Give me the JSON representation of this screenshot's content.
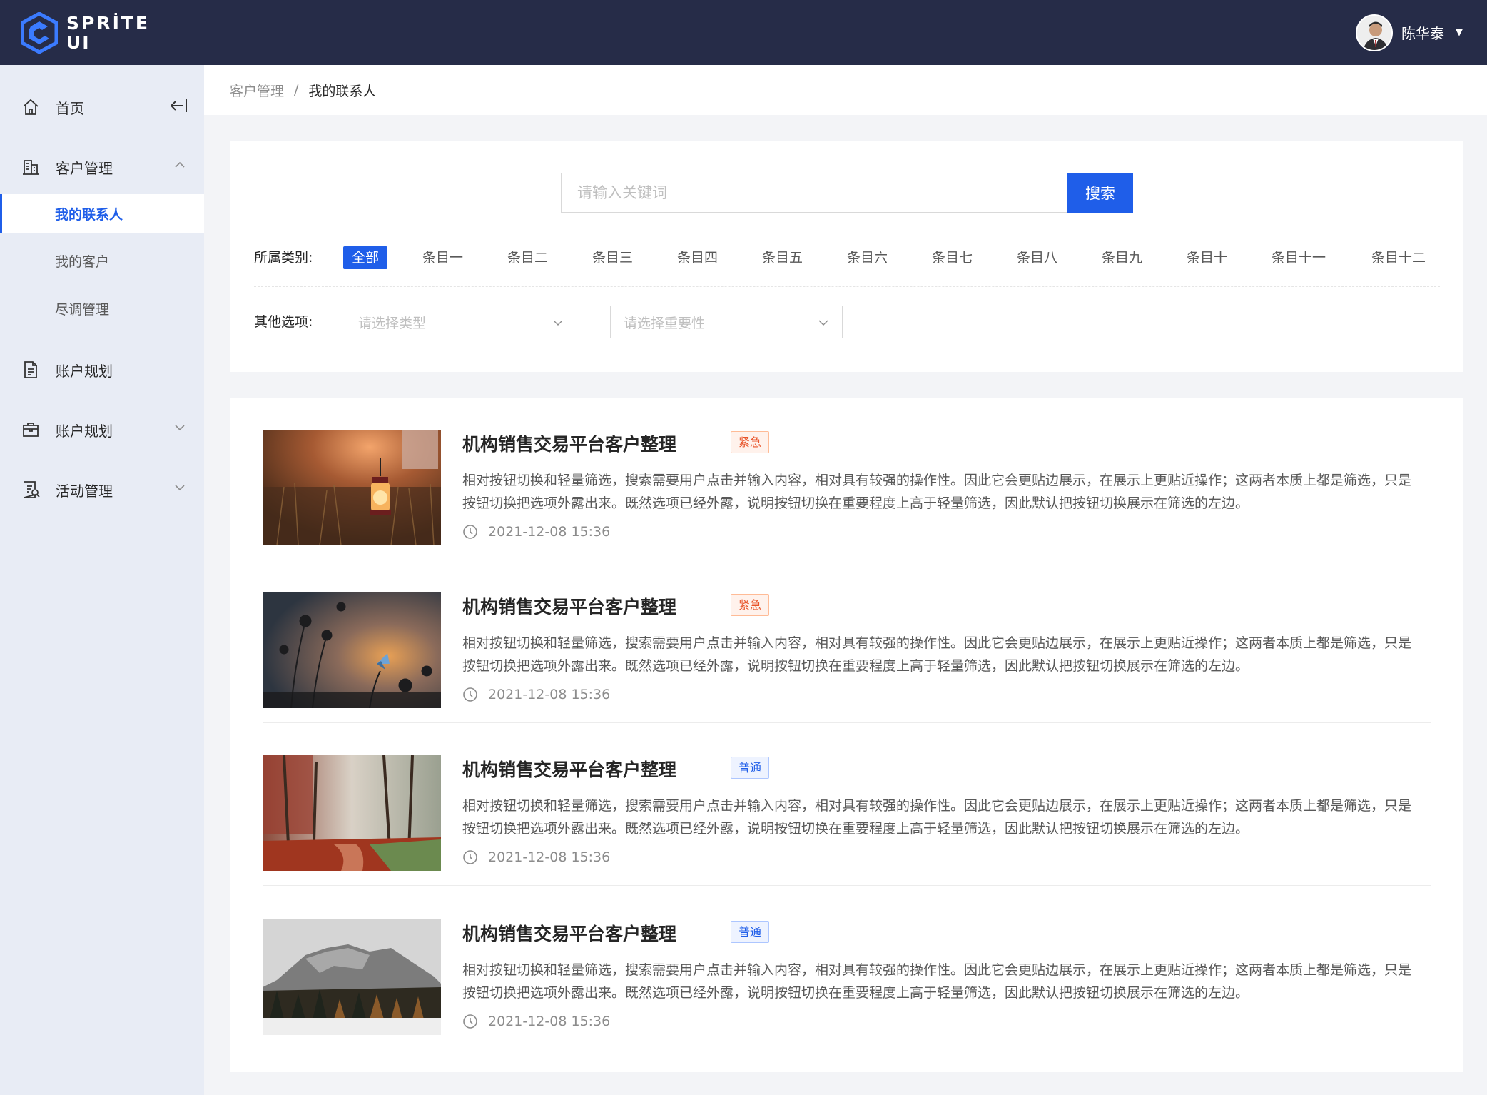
{
  "header": {
    "logo_line1": "SPRİTE",
    "logo_line2": "UI",
    "username": "陈华泰",
    "caret": "▼"
  },
  "sidebar": {
    "items": [
      {
        "label": "首页"
      },
      {
        "label": "客户管理"
      },
      {
        "label": "我的联系人"
      },
      {
        "label": "我的客户"
      },
      {
        "label": "尽调管理"
      },
      {
        "label": "账户规划"
      },
      {
        "label": "账户规划"
      },
      {
        "label": "活动管理"
      }
    ]
  },
  "breadcrumb": {
    "parent": "客户管理",
    "separator": "/",
    "current": "我的联系人"
  },
  "search": {
    "placeholder": "请输入关键词",
    "button": "搜索"
  },
  "filters": {
    "category_label": "所属类别:",
    "categories": [
      "全部",
      "条目一",
      "条目二",
      "条目三",
      "条目四",
      "条目五",
      "条目六",
      "条目七",
      "条目八",
      "条目九",
      "条目十",
      "条目十一",
      "条目十二"
    ],
    "selected_category": "全部",
    "other_label": "其他选项:",
    "type_placeholder": "请选择类型",
    "importance_placeholder": "请选择重要性"
  },
  "list": {
    "items": [
      {
        "title": "机构销售交易平台客户整理",
        "tag": "紧急",
        "desc": "相对按钮切换和轻量筛选，搜索需要用户点击并输入内容，相对具有较强的操作性。因此它会更贴边展示，在展示上更贴近操作；这两者本质上都是筛选，只是按钮切换把选项外露出来。既然选项已经外露，说明按钮切换在重要程度上高于轻量筛选，因此默认把按钮切换展示在筛选的左边。",
        "time": "2021-12-08  15:36"
      },
      {
        "title": "机构销售交易平台客户整理",
        "tag": "紧急",
        "desc": "相对按钮切换和轻量筛选，搜索需要用户点击并输入内容，相对具有较强的操作性。因此它会更贴边展示，在展示上更贴近操作；这两者本质上都是筛选，只是按钮切换把选项外露出来。既然选项已经外露，说明按钮切换在重要程度上高于轻量筛选，因此默认把按钮切换展示在筛选的左边。",
        "time": "2021-12-08  15:36"
      },
      {
        "title": "机构销售交易平台客户整理",
        "tag": "普通",
        "desc": "相对按钮切换和轻量筛选，搜索需要用户点击并输入内容，相对具有较强的操作性。因此它会更贴边展示，在展示上更贴近操作；这两者本质上都是筛选，只是按钮切换把选项外露出来。既然选项已经外露，说明按钮切换在重要程度上高于轻量筛选，因此默认把按钮切换展示在筛选的左边。",
        "time": "2021-12-08  15:36"
      },
      {
        "title": "机构销售交易平台客户整理",
        "tag": "普通",
        "desc": "相对按钮切换和轻量筛选，搜索需要用户点击并输入内容，相对具有较强的操作性。因此它会更贴边展示，在展示上更贴近操作；这两者本质上都是筛选，只是按钮切换把选项外露出来。既然选项已经外露，说明按钮切换在重要程度上高于轻量筛选，因此默认把按钮切换展示在筛选的左边。",
        "time": "2021-12-08  15:36"
      }
    ]
  },
  "colors": {
    "header_bg": "#262c48",
    "sidebar_bg": "#e8ecf5",
    "primary": "#1f5ee9",
    "urgent": "#e8542a"
  },
  "icons": {
    "home": "home-icon",
    "customer": "building-icon",
    "account_plan_1": "document-icon",
    "account_plan_2": "briefcase-icon",
    "activity": "activity-list-icon",
    "collapse": "collapse-left-icon",
    "time": "clock-icon"
  }
}
